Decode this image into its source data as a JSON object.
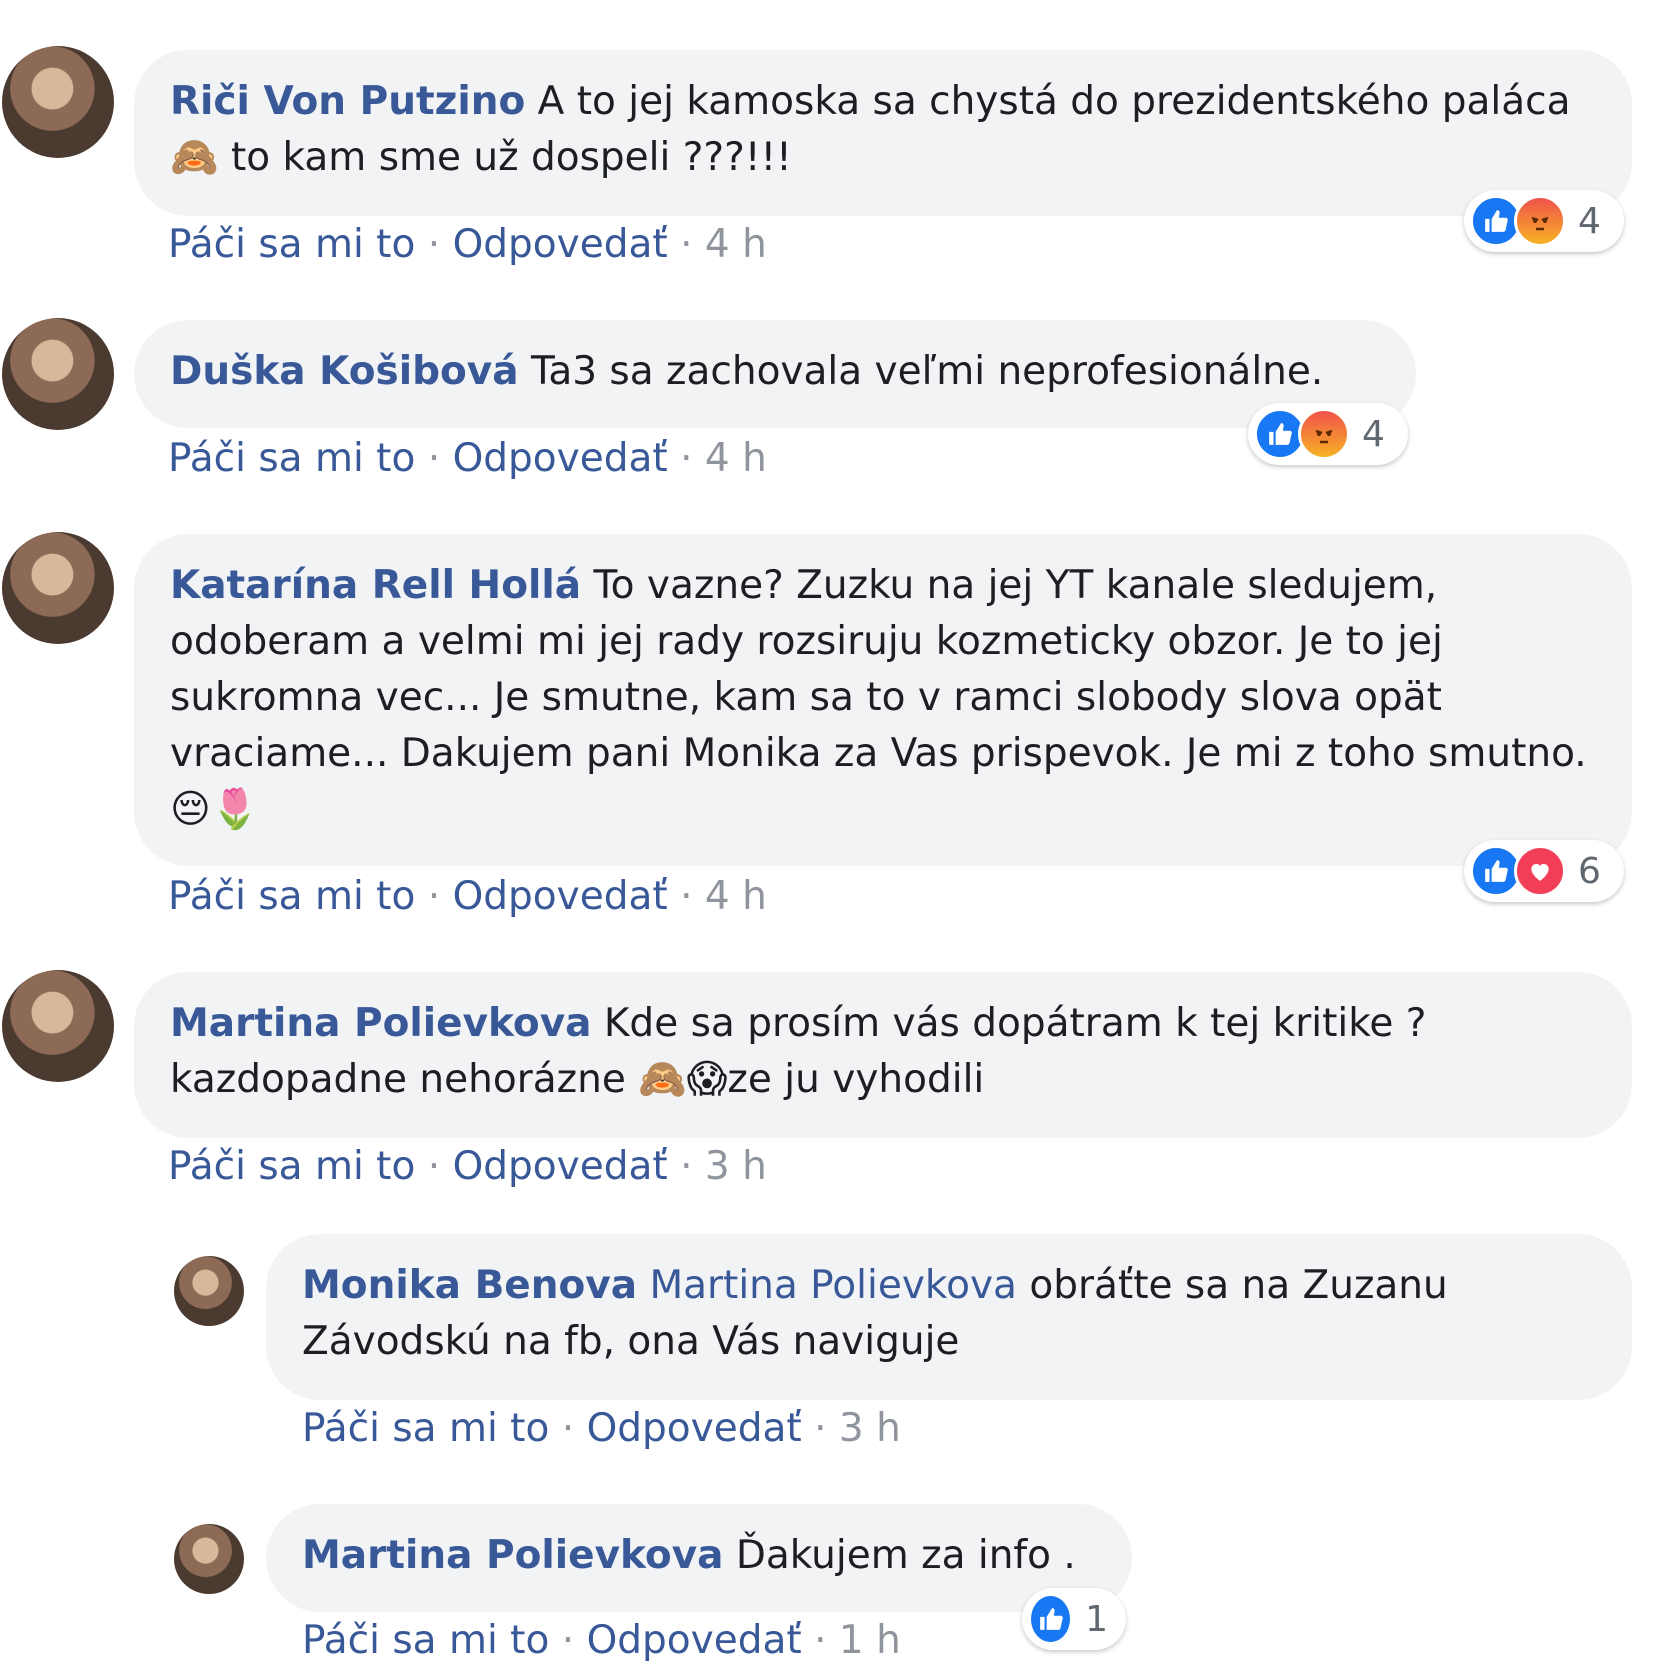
{
  "comments": [
    {
      "author": "Riči Von Putzino",
      "text": "A to jej kamoska sa chystá do prezidentského paláca 🙈 to kam sme už dospeli ???!!!",
      "like_label": "Páči sa mi to",
      "reply_label": "Odpovedať",
      "time": "4 h",
      "reaction_icons": [
        "like-icon",
        "angry-icon"
      ],
      "reaction_count": "4"
    },
    {
      "author": "Duška Košibová",
      "text": "Ta3 sa zachovala veľmi neprofesionálne.",
      "like_label": "Páči sa mi to",
      "reply_label": "Odpovedať",
      "time": "4 h",
      "reaction_icons": [
        "like-icon",
        "angry-icon"
      ],
      "reaction_count": "4"
    },
    {
      "author": "Katarína Rell Hollá",
      "text": "To vazne? Zuzku na jej YT kanale sledujem, odoberam a velmi mi jej rady rozsiruju kozmeticky obzor. Je to jej sukromna vec... Je smutne, kam sa to v ramci slobody slova opät vraciame... Dakujem pani Monika za Vas prispevok. Je mi z toho smutno. 😔🌷",
      "like_label": "Páči sa mi to",
      "reply_label": "Odpovedať",
      "time": "4 h",
      "reaction_icons": [
        "like-icon",
        "love-icon"
      ],
      "reaction_count": "6"
    },
    {
      "author": "Martina Polievkova",
      "text": "Kde sa prosím vás dopátram k tej kritike ? kazdopadne nehorázne 🙈😱ze ju vyhodili",
      "like_label": "Páči sa mi to",
      "reply_label": "Odpovedať",
      "time": "3 h"
    }
  ],
  "replies": [
    {
      "author": "Monika Benova",
      "mention": "Martina Polievkova",
      "text": " obráťte sa na Zuzanu Závodskú na fb, ona Vás naviguje",
      "like_label": "Páči sa mi to",
      "reply_label": "Odpovedať",
      "time": "3 h"
    },
    {
      "author": "Martina Polievkova",
      "text": "Ďakujem za info .",
      "like_label": "Páči sa mi to",
      "reply_label": "Odpovedať",
      "time": "1 h",
      "reaction_icons": [
        "like-icon"
      ],
      "reaction_count": "1"
    }
  ],
  "colors": {
    "link": "#385898",
    "bubble": "#f2f3f5",
    "meta": "#90949c",
    "like": "#1877f2"
  }
}
